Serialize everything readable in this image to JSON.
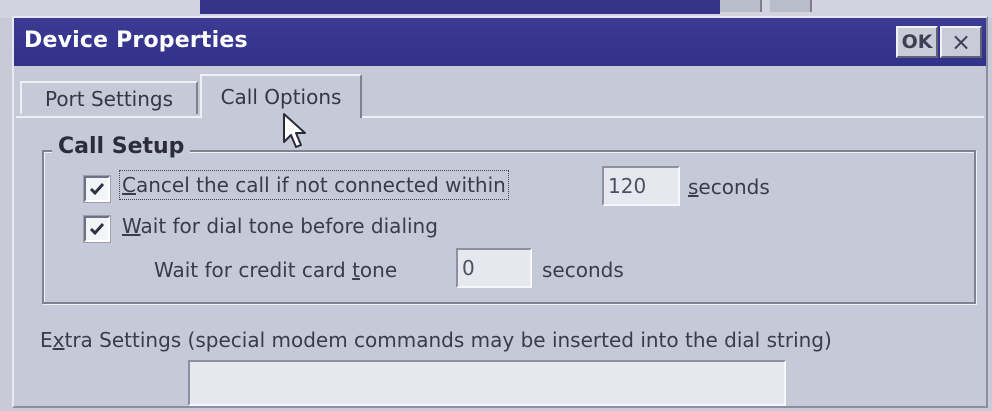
{
  "dialog": {
    "title": "Device Properties",
    "ok_label": "OK",
    "close_label": "×"
  },
  "tabs": [
    {
      "label": "Port Settings",
      "selected": false
    },
    {
      "label": "Call Options",
      "selected": true
    }
  ],
  "call_setup": {
    "legend": "Call Setup",
    "cancel_call": {
      "checked": true,
      "label_prefix": "C",
      "label_rest": "ancel the call if not connected within",
      "value": "120",
      "unit_prefix": "s",
      "unit_rest": "econds"
    },
    "wait_dial_tone": {
      "checked": true,
      "label_prefix": "W",
      "label_rest": "ait for dial tone before dialing"
    },
    "credit_card": {
      "label_start": "Wait for credit card ",
      "label_ul": "t",
      "label_end": "one",
      "value": "0",
      "unit": "seconds"
    }
  },
  "extra_settings": {
    "label_start": "E",
    "label_ul": "x",
    "label_end": "tra Settings (special modem commands may be inserted into the dial string)",
    "value": ""
  },
  "colors": {
    "titlebar": "#36368e",
    "dialog_bg": "#c6c9d8",
    "text": "#3a3b4c"
  }
}
